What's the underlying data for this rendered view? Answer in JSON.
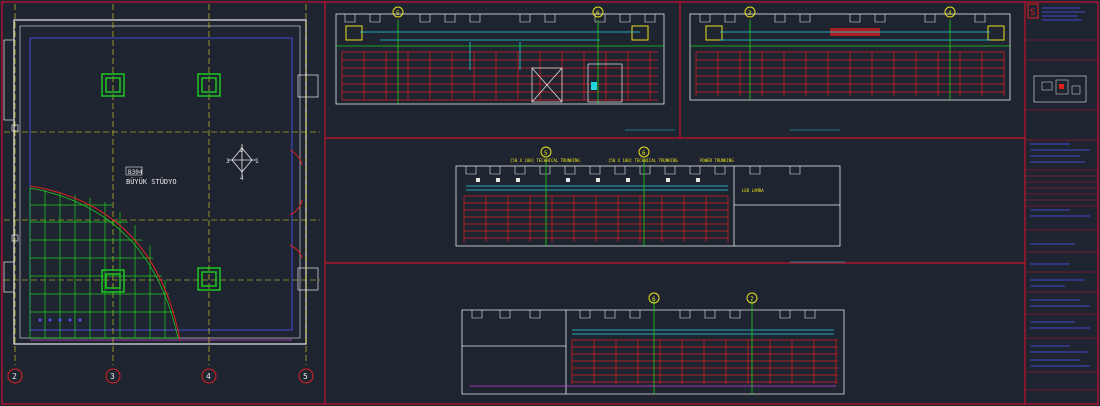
{
  "colors": {
    "background": "#1e2430",
    "frame": "#c8102e",
    "red": "#e02020",
    "green": "#1fd11f",
    "yellow": "#e8e020",
    "cyan": "#22d3e0",
    "magenta": "#d040d0",
    "blue": "#4f56ff",
    "white": "#e8e8e8"
  },
  "plan": {
    "room_code": "B304",
    "room_name": "BÜYÜK STÜDYO",
    "grid_bubbles": [
      "2",
      "3",
      "4",
      "5"
    ],
    "symbol_labels": [
      "2",
      "1",
      "3",
      "4"
    ]
  },
  "sections": {
    "top_left_bubbles": [
      "5",
      "6"
    ],
    "top_right_bubbles": [
      "3",
      "4"
    ],
    "middle_bubbles": [
      "5",
      "6"
    ],
    "bottom_bubbles": [
      "6",
      "7"
    ],
    "middle_notes": {
      "note_1": "[50 X 100] TECHNICAL TRUNKING",
      "note_2": "[50 X 100] TECHNICAL TRUNKING",
      "note_3": "POWER TRUNKING",
      "note_4": "LED LAMBA"
    }
  },
  "title_block": {
    "logo_text": "S"
  }
}
